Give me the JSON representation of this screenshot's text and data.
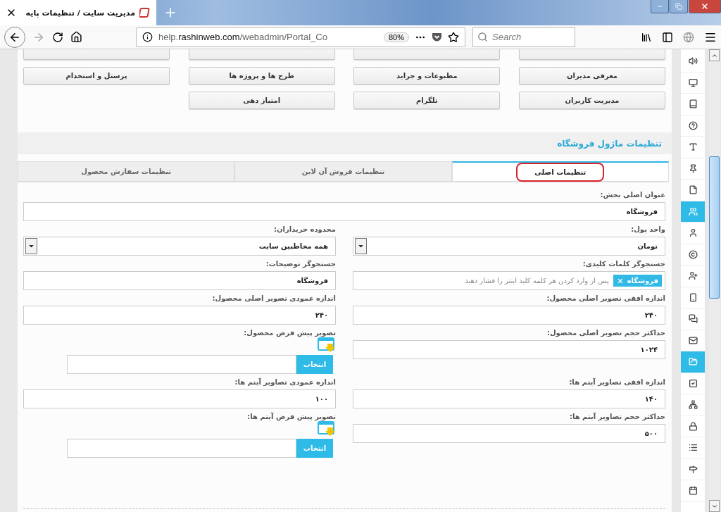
{
  "browser": {
    "tab_title": "مدیریت سایت / تنظیمات پایه",
    "url_host": "help.",
    "url_domain": "rashinweb.com",
    "url_path": "/webadmin/Portal_Co",
    "zoom": "80%",
    "search_placeholder": "Search"
  },
  "menu_buttons": [
    {
      "kind": "cut"
    },
    {
      "kind": "cut"
    },
    {
      "kind": "cut"
    },
    {
      "kind": "cut"
    },
    {
      "kind": "button",
      "label": "معرفی مدیران"
    },
    {
      "kind": "button",
      "label": "مطبوعات و جراید"
    },
    {
      "kind": "button",
      "label": "طرح ها و پروژه ها"
    },
    {
      "kind": "button",
      "label": "پرسنل و استخدام"
    },
    {
      "kind": "button",
      "label": "مدیریت کاربران"
    },
    {
      "kind": "button",
      "label": "تلگرام"
    },
    {
      "kind": "button",
      "label": "امتیاز دهی"
    }
  ],
  "section_title": "تنظیمات ماژول فروشگاه",
  "tabs": [
    {
      "label": "تنظیمات اصلی",
      "selected": true,
      "circled": true
    },
    {
      "label": "تنظیمات فروش آن لاین",
      "selected": false,
      "circled": false
    },
    {
      "label": "تنظیمات سفارش محصول",
      "selected": false,
      "circled": false
    }
  ],
  "form_rows": [
    {
      "fields": [
        {
          "kind": "text",
          "label": "عنوان اصلی بخش:",
          "value": "فروشگاه"
        }
      ]
    },
    {
      "fields": [
        {
          "kind": "select",
          "label": "واحد پول:",
          "value": "تومان"
        },
        {
          "kind": "select",
          "label": "محدوده خریداران:",
          "value": "همه مخاطبین سایت"
        }
      ]
    },
    {
      "fields": [
        {
          "kind": "tags",
          "label": "جستجوگر کلمات کلیدی:",
          "tags": [
            "فروشگاه"
          ],
          "placeholder": "پس از وارد کردن هر کلمه کلید اینتر را فشار دهید"
        },
        {
          "kind": "text",
          "label": "جستجوگر توضیحات:",
          "value": "فروشگاه"
        }
      ]
    },
    {
      "fields": [
        {
          "kind": "text",
          "label": "اندازه افقی تصویر اصلی محصول:",
          "value": "۲۴۰"
        },
        {
          "kind": "text",
          "label": "اندازه عمودی تصویر اصلی محصول:",
          "value": "۲۴۰"
        }
      ]
    },
    {
      "fields": [
        {
          "kind": "text",
          "label": "حداکثر حجم تصویر اصلی محصول:",
          "value": "۱۰۲۴"
        },
        {
          "kind": "image",
          "label": "تصویر پیش فرض محصول:",
          "button": "انتخاب"
        }
      ]
    },
    {
      "fields": [
        {
          "kind": "text",
          "label": "اندازه افقی تصاویر آیتم ها:",
          "value": "۱۴۰"
        },
        {
          "kind": "text",
          "label": "اندازه عمودی تصاویر آیتم ها:",
          "value": "۱۰۰"
        }
      ]
    },
    {
      "fields": [
        {
          "kind": "text",
          "label": "حداکثر حجم تصاویر آیتم ها:",
          "value": "۵۰۰"
        },
        {
          "kind": "image",
          "label": "تصویر پیش فرض آیتم ها:",
          "button": "انتخاب"
        }
      ]
    }
  ],
  "sidebar": [
    {
      "selected": false
    },
    {
      "selected": false
    },
    {
      "selected": false
    },
    {
      "selected": false
    },
    {
      "selected": false
    },
    {
      "selected": false
    },
    {
      "selected": false
    },
    {
      "selected": true
    },
    {
      "selected": false
    },
    {
      "selected": false
    },
    {
      "selected": false
    },
    {
      "selected": false
    },
    {
      "selected": false
    },
    {
      "selected": false
    },
    {
      "selected": true
    },
    {
      "selected": false
    },
    {
      "selected": false
    },
    {
      "selected": false
    },
    {
      "selected": false
    },
    {
      "selected": false
    },
    {
      "selected": false
    }
  ]
}
